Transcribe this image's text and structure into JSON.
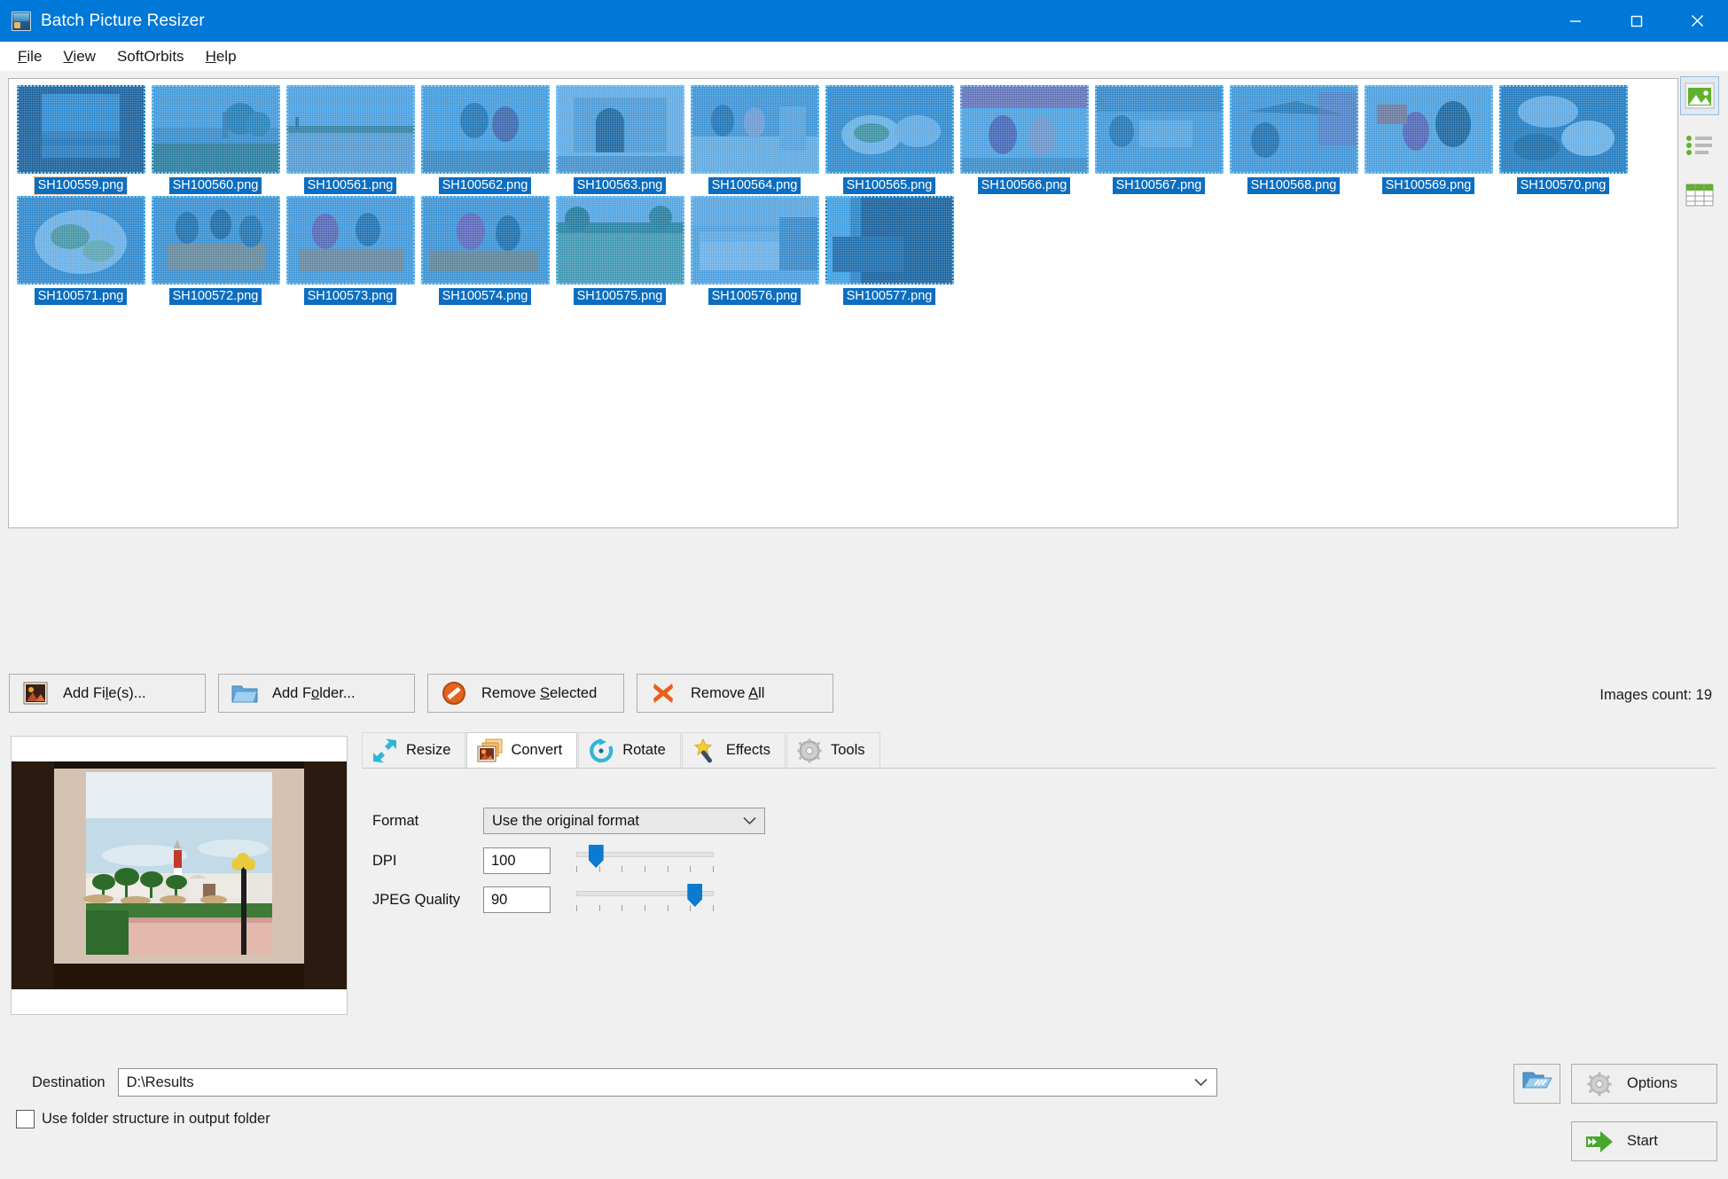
{
  "window": {
    "title": "Batch Picture Resizer",
    "icon": "app-icon",
    "minimize": "minimize-icon",
    "maximize": "maximize-icon",
    "close": "close-icon"
  },
  "menu": [
    {
      "label": "File",
      "accel": "F"
    },
    {
      "label": "View",
      "accel": "V"
    },
    {
      "label": "SoftOrbits",
      "accel": ""
    },
    {
      "label": "Help",
      "accel": "H"
    }
  ],
  "thumbnails": {
    "selected_all": true,
    "focused_index": 0,
    "items": [
      {
        "name": "SH100559.png"
      },
      {
        "name": "SH100560.png"
      },
      {
        "name": "SH100561.png"
      },
      {
        "name": "SH100562.png"
      },
      {
        "name": "SH100563.png"
      },
      {
        "name": "SH100564.png"
      },
      {
        "name": "SH100565.png"
      },
      {
        "name": "SH100566.png"
      },
      {
        "name": "SH100567.png"
      },
      {
        "name": "SH100568.png"
      },
      {
        "name": "SH100569.png"
      },
      {
        "name": "SH100570.png"
      },
      {
        "name": "SH100571.png"
      },
      {
        "name": "SH100572.png"
      },
      {
        "name": "SH100573.png"
      },
      {
        "name": "SH100574.png"
      },
      {
        "name": "SH100575.png"
      },
      {
        "name": "SH100576.png"
      },
      {
        "name": "SH100577.png"
      }
    ]
  },
  "view_modes": [
    {
      "name": "thumbnails-view",
      "icon": "picture-icon",
      "active": true
    },
    {
      "name": "list-view",
      "icon": "list-icon",
      "active": false
    },
    {
      "name": "details-view",
      "icon": "table-icon",
      "active": false
    }
  ],
  "toolbar": {
    "add_files": {
      "label_pre": "Add Fi",
      "accel": "l",
      "label_post": "e(s)...",
      "icon": "picture-add-icon"
    },
    "add_folder": {
      "label_pre": "Add F",
      "accel": "o",
      "label_post": "lder...",
      "icon": "folder-icon"
    },
    "remove_selected": {
      "label_pre": "Remove ",
      "accel": "S",
      "label_post": "elected",
      "icon": "no-entry-icon"
    },
    "remove_all": {
      "label_pre": "Remove ",
      "accel": "A",
      "label_post": "ll",
      "icon": "cross-icon"
    },
    "images_count": "Images count: 19"
  },
  "tabs": [
    {
      "label": "Resize",
      "icon": "resize-arrows-icon",
      "active": false
    },
    {
      "label": "Convert",
      "icon": "convert-images-icon",
      "active": true
    },
    {
      "label": "Rotate",
      "icon": "rotate-arrow-icon",
      "active": false
    },
    {
      "label": "Effects",
      "icon": "magic-wand-icon",
      "active": false
    },
    {
      "label": "Tools",
      "icon": "gear-icon",
      "active": false
    }
  ],
  "convert": {
    "format_label": "Format",
    "format_value": "Use the original format",
    "dpi_label": "DPI",
    "dpi_value": "100",
    "dpi_slider_percent": 14,
    "jpeg_label": "JPEG Quality",
    "jpeg_value": "90",
    "jpeg_slider_percent": 86,
    "slider_ticks": 7
  },
  "bottom": {
    "destination_label": "Destination",
    "destination_value": "D:\\Results",
    "browse_icon": "open-folder-icon",
    "use_folder_structure_label": "Use folder structure in output folder",
    "use_folder_structure_checked": false,
    "options_label": "Options",
    "options_icon": "gear-icon",
    "start_label": "Start",
    "start_icon": "green-arrow-icon"
  },
  "colors": {
    "titlebar": "#0078d7",
    "selection": "#0d6ec0",
    "accent_green": "#5cb22c",
    "accent_cyan": "#2eb6d8",
    "accent_orange": "#e8601c",
    "slider_blue": "#0b7ad1",
    "window_bg": "#f0f0f0"
  }
}
